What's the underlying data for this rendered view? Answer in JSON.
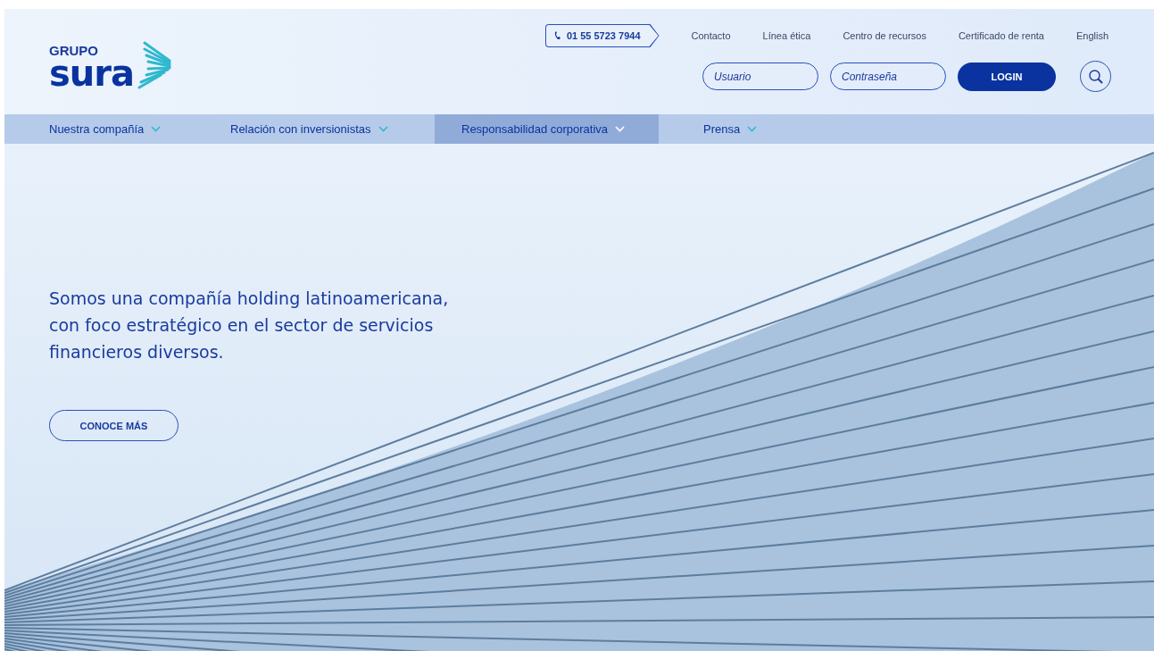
{
  "logo": {
    "top": "GRUPO",
    "main": "sura"
  },
  "phone": "01 55 5723 7944",
  "top_links": [
    "Contacto",
    "Línea ética",
    "Centro de recursos",
    "Certificado de renta",
    "English"
  ],
  "login": {
    "user_placeholder": "Usuario",
    "password_placeholder": "Contraseña",
    "button": "LOGIN"
  },
  "nav": [
    {
      "label": "Nuestra compañía",
      "selected": false
    },
    {
      "label": "Relación con inversionistas",
      "selected": false
    },
    {
      "label": "Responsabilidad corporativa",
      "selected": true
    },
    {
      "label": "Prensa",
      "selected": false
    }
  ],
  "hero": {
    "text": "Somos una compañía holding latinoamericana, con foco estratégico en el sector de servicios financieros diversos.",
    "button": "CONOCE MÁS"
  }
}
